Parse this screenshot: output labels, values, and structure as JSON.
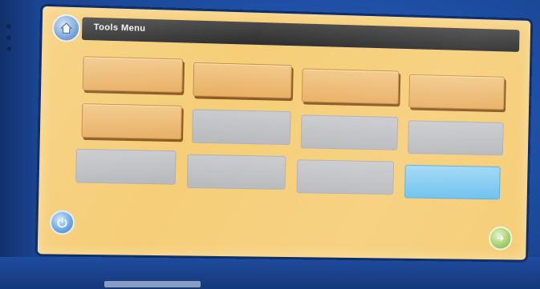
{
  "titlebar": {
    "title": "Tools Menu"
  },
  "tiles": [
    {
      "label": "",
      "state": "active"
    },
    {
      "label": "",
      "state": "active"
    },
    {
      "label": "",
      "state": "active"
    },
    {
      "label": "",
      "state": "active"
    },
    {
      "label": "",
      "state": "active"
    },
    {
      "label": "",
      "state": "empty"
    },
    {
      "label": "",
      "state": "empty"
    },
    {
      "label": "",
      "state": "empty"
    },
    {
      "label": "",
      "state": "empty"
    },
    {
      "label": "",
      "state": "empty"
    },
    {
      "label": "",
      "state": "empty"
    },
    {
      "label": "",
      "state": "blue"
    }
  ],
  "footer": {
    "left_text": "",
    "right_text": ""
  },
  "icons": {
    "home": "home-icon",
    "power": "power-icon",
    "next": "next-arrow-icon"
  },
  "colors": {
    "screen_background": "#f6ce78",
    "active_tile": "#e7b064",
    "empty_tile": "#b7b9bd",
    "blue_tile": "#6cc0ee",
    "bezel": "#1f4fa8"
  }
}
